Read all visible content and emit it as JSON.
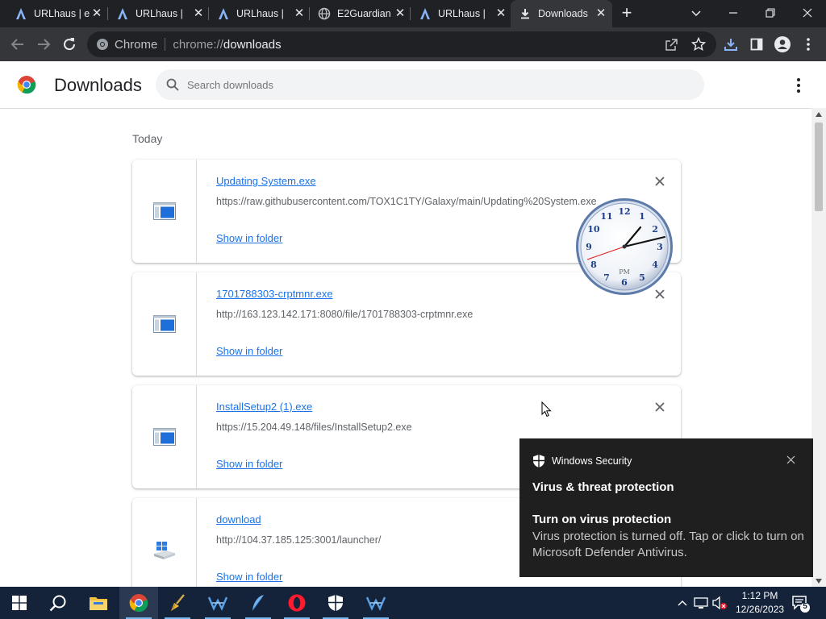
{
  "browser": {
    "tabs": [
      {
        "title": "URLhaus | e",
        "icon": "urlhaus-icon"
      },
      {
        "title": "URLhaus | ",
        "icon": "urlhaus-icon"
      },
      {
        "title": "URLhaus | ",
        "icon": "urlhaus-icon"
      },
      {
        "title": "E2Guardian",
        "icon": "globe-icon"
      },
      {
        "title": "URLhaus | ",
        "icon": "urlhaus-icon"
      },
      {
        "title": "Downloads",
        "icon": "download-icon",
        "active": true
      }
    ],
    "omnibox": {
      "site_label": "Chrome",
      "url_prefix": "chrome://",
      "url_host": "downloads"
    }
  },
  "page": {
    "title": "Downloads",
    "search_placeholder": "Search downloads",
    "section_label": "Today",
    "downloads": [
      {
        "name": "Updating System.exe",
        "url": "https://raw.githubusercontent.com/TOX1C1TY/Galaxy/main/Updating%20System.exe",
        "action": "Show in folder",
        "icon": "executable-file-icon"
      },
      {
        "name": "1701788303-crptmnr.exe",
        "url": "http://163.123.142.171:8080/file/1701788303-crptmnr.exe",
        "action": "Show in folder",
        "icon": "executable-file-icon"
      },
      {
        "name": "InstallSetup2 (1).exe",
        "url": "https://15.204.49.148/files/InstallSetup2.exe",
        "action": "Show in folder",
        "icon": "executable-file-icon"
      },
      {
        "name": "download",
        "url": "http://104.37.185.125:3001/launcher/",
        "action": "Show in folder",
        "icon": "installer-file-icon"
      }
    ]
  },
  "desktop_clock_gadget": {
    "numerals": [
      "12",
      "1",
      "2",
      "3",
      "4",
      "5",
      "6",
      "7",
      "8",
      "9",
      "10",
      "11"
    ],
    "period": "PM"
  },
  "toast": {
    "app": "Windows Security",
    "category": "Virus & threat protection",
    "heading": "Turn on virus protection",
    "body": "Virus protection is turned off. Tap or click to turn on Microsoft Defender Antivirus."
  },
  "taskbar": {
    "apps": [
      "start-icon",
      "search-icon",
      "file-explorer-icon",
      "chrome-icon",
      "cleaner-icon",
      "net-tool-icon",
      "feather-icon",
      "opera-icon",
      "security-shield-icon",
      "net-tool-icon"
    ],
    "time": "1:12 PM",
    "date": "12/26/2023",
    "notification_count": "5"
  },
  "colors": {
    "link": "#1a73e8",
    "chrome_dark": "#202124",
    "toolbar": "#35363a",
    "taskbar": "#14233a",
    "toast_bg": "#1f1f1f"
  }
}
